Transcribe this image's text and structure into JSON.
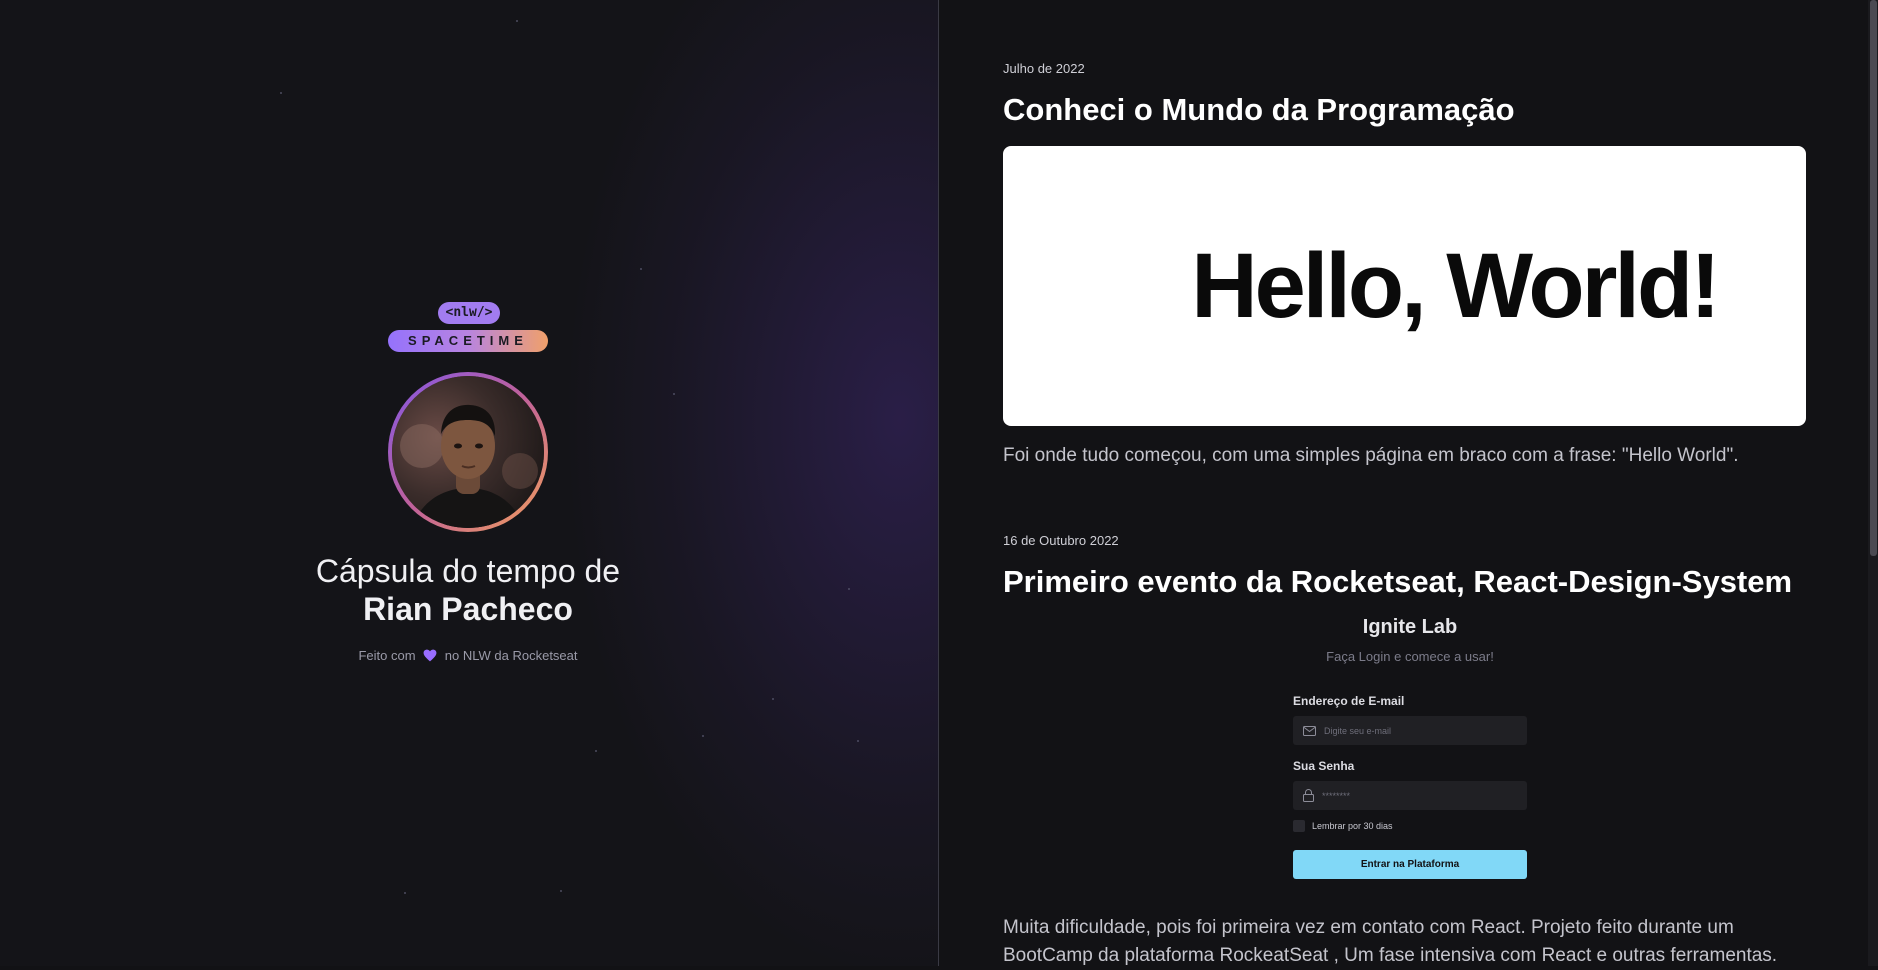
{
  "left": {
    "brand": {
      "tag": "<nlw/>",
      "name": "SPACETIME"
    },
    "capsule": {
      "line1": "Cápsula do tempo de",
      "name": "Rian Pacheco"
    },
    "footer": {
      "before": "Feito com",
      "after": "no NLW da Rocketseat"
    }
  },
  "memories": [
    {
      "date": "Julho de 2022",
      "title": "Conheci o Mundo da Programação",
      "image_text": "Hello, World!",
      "description": "Foi onde tudo começou, com uma simples página em braco com a frase: \"Hello World\"."
    },
    {
      "date": "16 de Outubro 2022",
      "title": "Primeiro evento da Rocketseat, React-Design-System",
      "description_line1": "Muita dificuldade, pois foi primeira vez em contato com React. Projeto feito durante um",
      "description_line2": "BootCamp da plataforma RockeatSeat , Um fase intensiva com React e outras ferramentas."
    }
  ],
  "login_preview": {
    "title": "Ignite Lab",
    "subtitle": "Faça Login e comece a usar!",
    "email_label": "Endereço de E-mail",
    "email_placeholder": "Digite seu e-mail",
    "password_label": "Sua Senha",
    "password_placeholder": "********",
    "remember": "Lembrar por 30 dias",
    "submit": "Entrar na Plataforma"
  },
  "colors": {
    "accent_purple": "#8257e6",
    "accent_orange": "#f3a05a",
    "ignite_cyan": "#81d8f7"
  }
}
